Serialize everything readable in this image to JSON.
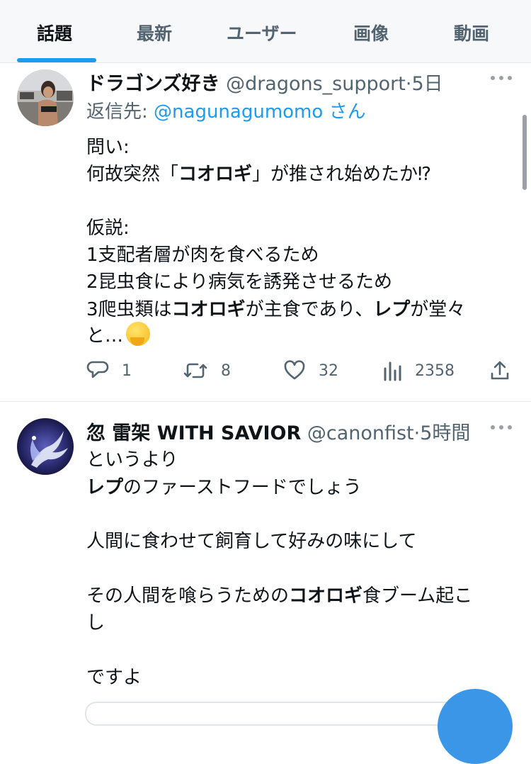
{
  "tabs": [
    {
      "label": "話題",
      "active": true
    },
    {
      "label": "最新",
      "active": false
    },
    {
      "label": "ユーザー",
      "active": false
    },
    {
      "label": "画像",
      "active": false
    },
    {
      "label": "動画",
      "active": false
    }
  ],
  "tweets": [
    {
      "name": "ドラゴンズ好き",
      "handle": "@dragons_support",
      "dot": "·",
      "time": "5日",
      "reply_prefix": "返信先:",
      "reply_mention": "@nagunagumomo",
      "reply_suffix": "さん",
      "lines": {
        "l1": "問い:",
        "l2a": "何故突然「",
        "l2b": "コオロギ",
        "l2c": "」が推され始めたか⁉",
        "l3": "仮説:",
        "l4": "1支配者層が肉を食べるため",
        "l5": "2昆虫食により病気を誘発させるため",
        "l6a": "3爬虫類は",
        "l6b": "コオロギ",
        "l6c": "が主食であり、",
        "l6d": "レプ",
        "l6e": "が堂々",
        "l7": "と…"
      },
      "stats": {
        "replies": "1",
        "retweets": "8",
        "likes": "32",
        "views": "2358"
      }
    },
    {
      "name": "忽 雷架 WITH SAVIOR",
      "handle": "@canonfist",
      "dot": "·",
      "time": "5時間",
      "lines": {
        "l1": "というより",
        "l2a": "レプ",
        "l2b": "のファーストフードでしょう",
        "l3": "人間に食わせて飼育して好みの味にして",
        "l4a": "その人間を喰らうための",
        "l4b": "コオロギ",
        "l4c": "食ブーム起こ",
        "l5": "し",
        "l6": "ですよ"
      }
    }
  ],
  "colors": {
    "accent": "#1d9bf0",
    "text_primary": "#0f1419",
    "text_secondary": "#536471"
  },
  "icons": [
    "reply-icon",
    "retweet-icon",
    "like-icon",
    "views-icon",
    "share-icon",
    "more-icon"
  ]
}
